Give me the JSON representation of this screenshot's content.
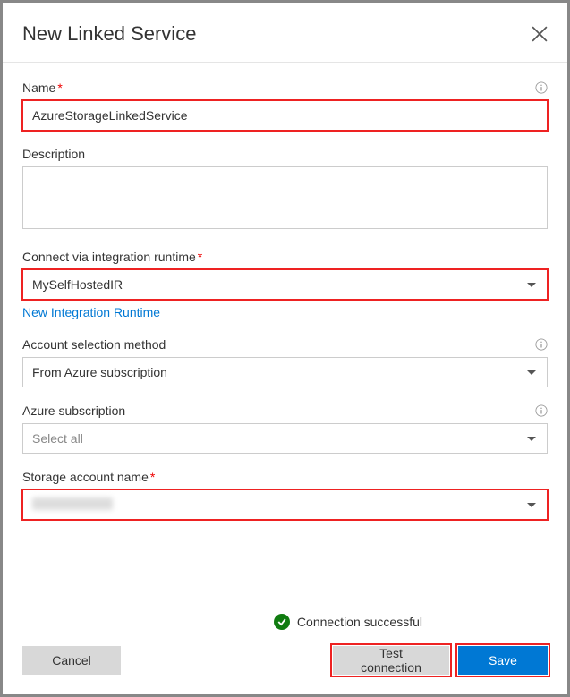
{
  "header": {
    "title": "New Linked Service"
  },
  "form": {
    "name": {
      "label": "Name",
      "value": "AzureStorageLinkedService"
    },
    "description": {
      "label": "Description",
      "value": ""
    },
    "runtime": {
      "label": "Connect via integration runtime",
      "value": "MySelfHostedIR",
      "newLink": "New Integration Runtime"
    },
    "accountMethod": {
      "label": "Account selection method",
      "value": "From Azure subscription"
    },
    "subscription": {
      "label": "Azure subscription",
      "value": "Select all"
    },
    "storageAccount": {
      "label": "Storage account name"
    }
  },
  "status": {
    "message": "Connection successful"
  },
  "buttons": {
    "cancel": "Cancel",
    "test": "Test connection",
    "save": "Save"
  }
}
